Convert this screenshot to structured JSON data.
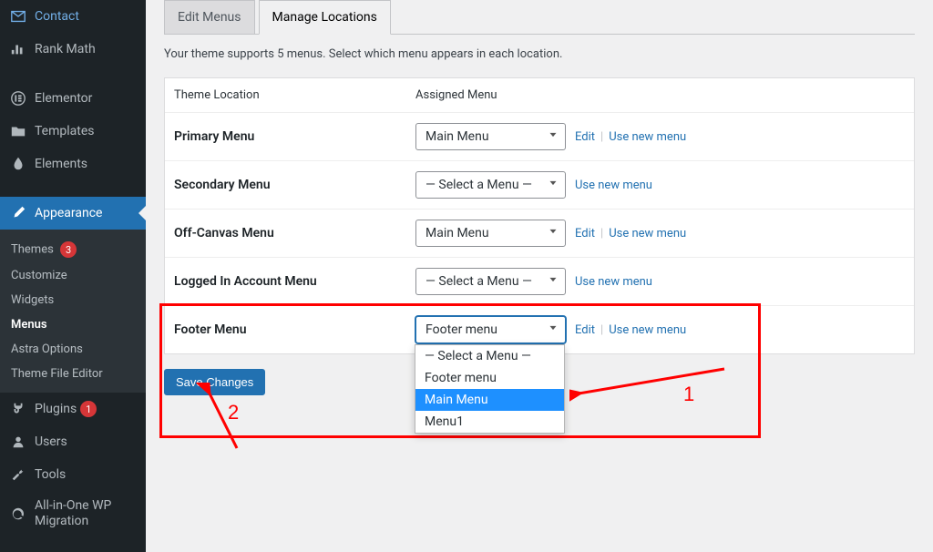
{
  "sidebar": {
    "items_top": [
      {
        "icon": "contact",
        "label": "Contact"
      },
      {
        "icon": "rankmath",
        "label": "Rank Math"
      }
    ],
    "items_mid": [
      {
        "icon": "elementor",
        "label": "Elementor"
      },
      {
        "icon": "templates",
        "label": "Templates"
      },
      {
        "icon": "elements",
        "label": "Elements"
      }
    ],
    "appearance": {
      "label": "Appearance",
      "sub": [
        {
          "label": "Themes",
          "badge": "3"
        },
        {
          "label": "Customize"
        },
        {
          "label": "Widgets"
        },
        {
          "label": "Menus",
          "current": true
        },
        {
          "label": "Astra Options"
        },
        {
          "label": "Theme File Editor"
        }
      ]
    },
    "items_bot": [
      {
        "icon": "plugin",
        "label": "Plugins",
        "badge": "1"
      },
      {
        "icon": "users",
        "label": "Users"
      },
      {
        "icon": "tools",
        "label": "Tools"
      },
      {
        "icon": "aio",
        "label": "All-in-One WP Migration"
      }
    ]
  },
  "tabs": {
    "edit": "Edit Menus",
    "manage": "Manage Locations"
  },
  "description": "Your theme supports 5 menus. Select which menu appears in each location.",
  "headers": {
    "location": "Theme Location",
    "menu": "Assigned Menu"
  },
  "rows": [
    {
      "label": "Primary Menu",
      "selected": "Main Menu",
      "edit": true
    },
    {
      "label": "Secondary Menu",
      "selected": "— Select a Menu —",
      "edit": false
    },
    {
      "label": "Off-Canvas Menu",
      "selected": "Main Menu",
      "edit": true
    },
    {
      "label": "Logged In Account Menu",
      "selected": "— Select a Menu —",
      "edit": false
    },
    {
      "label": "Footer Menu",
      "selected": "Footer menu",
      "edit": true
    }
  ],
  "links": {
    "edit": "Edit",
    "usenew": "Use new menu"
  },
  "dropdown": [
    "— Select a Menu —",
    "Footer menu",
    "Main Menu",
    "Menu1"
  ],
  "save": "Save Changes",
  "annotations": {
    "a1": "1",
    "a2": "2"
  }
}
